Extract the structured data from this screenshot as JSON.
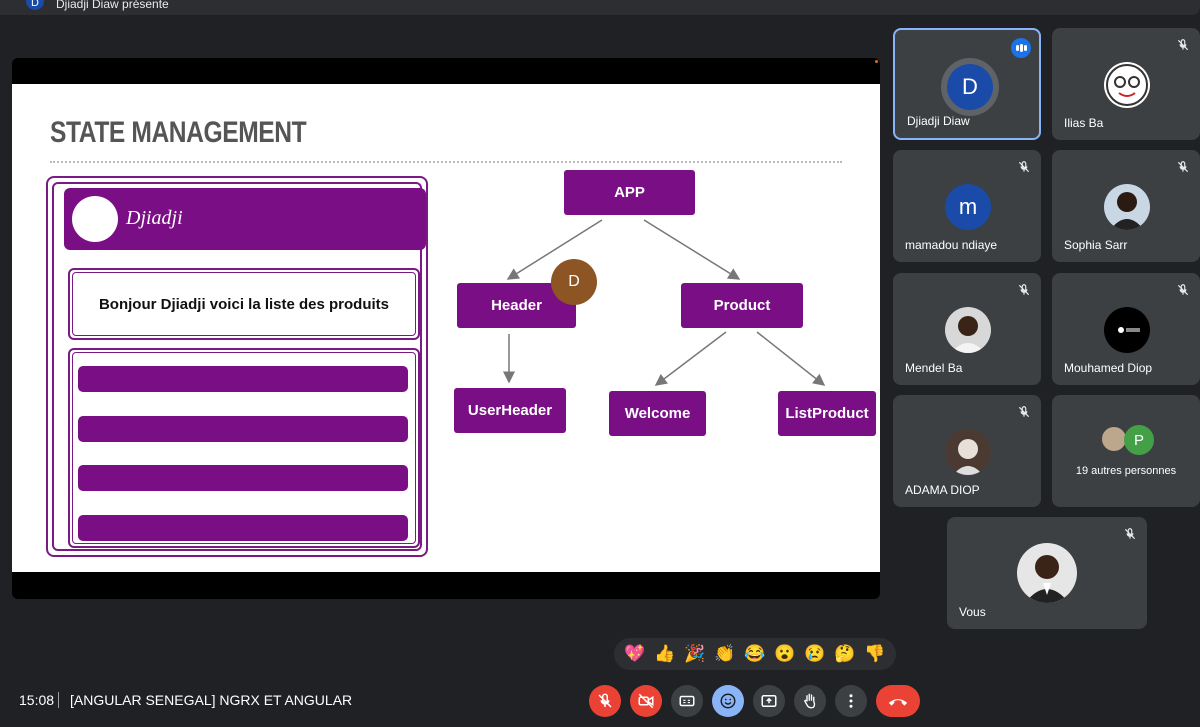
{
  "presenter": {
    "initial": "D",
    "text": "Djiadji Diaw présente"
  },
  "slide": {
    "title": "STATE MANAGEMENT",
    "app_mock": {
      "user_name": "Djiadji",
      "greeting": "Bonjour Djiadji voici la liste des produits",
      "list_bars": 4
    },
    "tree": {
      "root": "APP",
      "header": "Header",
      "product": "Product",
      "user_header": "UserHeader",
      "welcome": "Welcome",
      "list_product": "ListProduct"
    },
    "cursor_initial": "D"
  },
  "participants": [
    {
      "name": "Djiadji Diaw",
      "initial": "D",
      "avatar_color": "#1a4ba8",
      "speaking": true
    },
    {
      "name": "Ilias Ba",
      "initial": "",
      "avatar_color": "#ffffff",
      "muted": true
    },
    {
      "name": "mamadou ndiaye",
      "initial": "m",
      "avatar_color": "#1a4ba8",
      "muted": true
    },
    {
      "name": "Sophia Sarr",
      "initial": "",
      "avatar_color": "#c9d6e3",
      "muted": true
    },
    {
      "name": "Mendel Ba",
      "initial": "",
      "avatar_color": "#d8d8d8",
      "muted": true
    },
    {
      "name": "Mouhamed Diop",
      "initial": "",
      "avatar_color": "#000000",
      "muted": true
    },
    {
      "name": "ADAMA DIOP",
      "initial": "",
      "avatar_color": "#6b4a3a",
      "muted": true
    },
    {
      "name": "19 autres personnes",
      "initial": "P",
      "avatar_color": "#43a047"
    },
    {
      "name": "Vous",
      "initial": "",
      "avatar_color": "#e6e6e6",
      "muted": true
    }
  ],
  "reactions": [
    "💖",
    "👍",
    "🎉",
    "👏",
    "😂",
    "😮",
    "😢",
    "🤔",
    "👎"
  ],
  "bottom": {
    "time": "15:08",
    "meeting_title": "[ANGULAR SENEGAL] NGRX ET ANGULAR"
  },
  "colors": {
    "accent": "#7a0f85",
    "end_call": "#ea4335",
    "active_border": "#8ab4f8"
  }
}
